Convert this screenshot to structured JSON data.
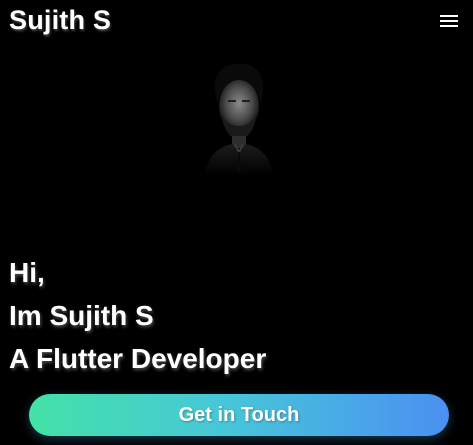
{
  "header": {
    "brand": "Sujith S",
    "menu_icon": "menu-icon"
  },
  "hero": {
    "portrait_icon": "profile-photo",
    "greeting": "Hi,",
    "intro": "Im Sujith S",
    "role": "A Flutter Developer"
  },
  "cta": {
    "label": "Get in Touch"
  },
  "colors": {
    "background": "#000000",
    "text": "#ffffff",
    "cta_gradient_start": "#43e2a6",
    "cta_gradient_end": "#4a90f2"
  }
}
